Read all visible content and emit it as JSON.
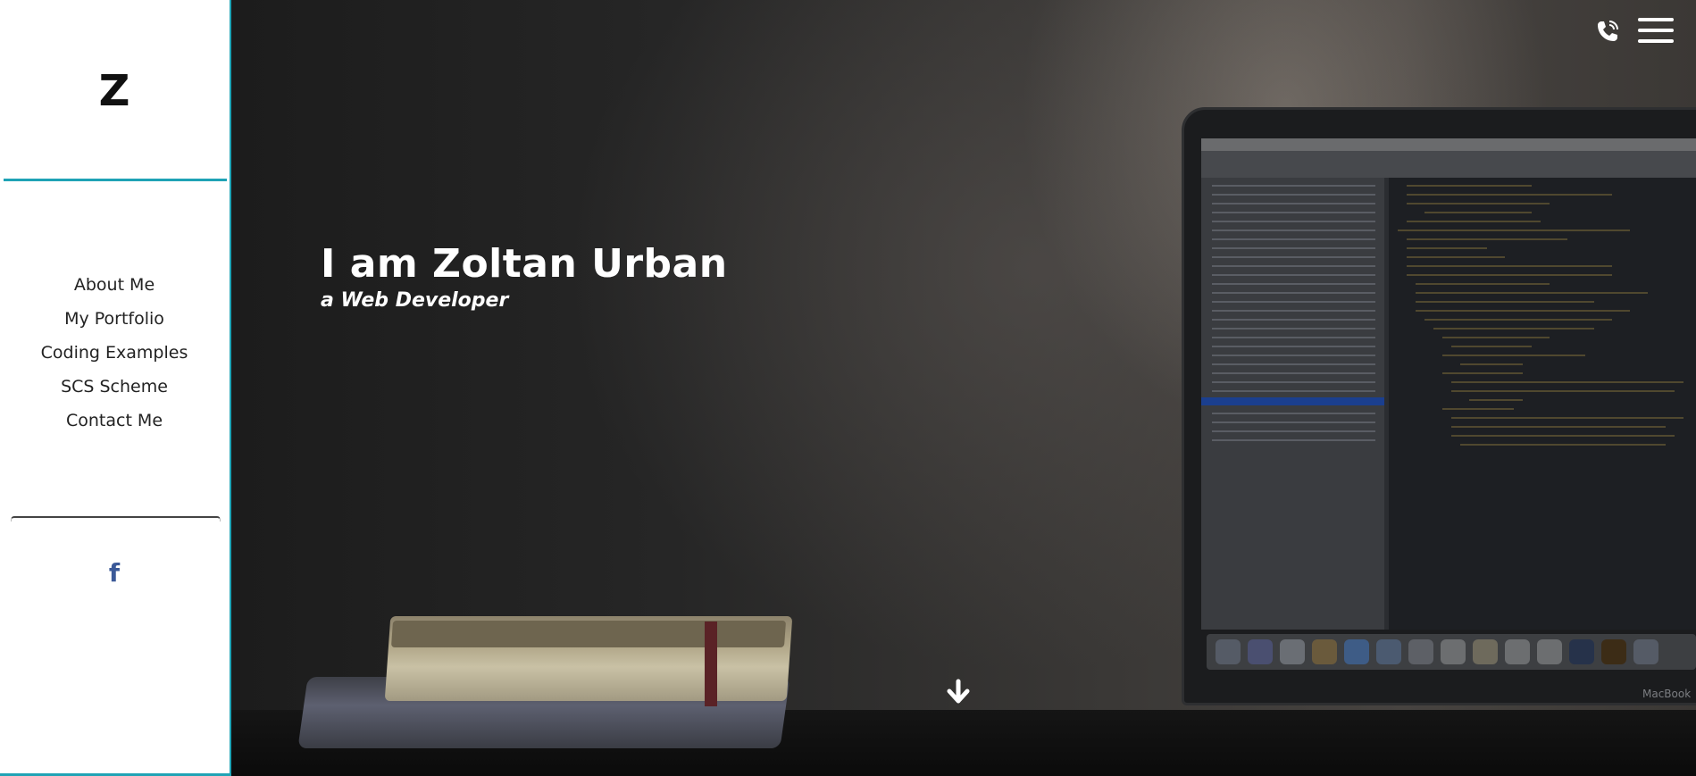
{
  "sidebar": {
    "logo": "Z",
    "nav_items": [
      {
        "label": "About Me"
      },
      {
        "label": "My Portfolio"
      },
      {
        "label": "Coding Examples"
      },
      {
        "label": "SCS Scheme"
      },
      {
        "label": "Contact Me"
      }
    ],
    "social": {
      "facebook_glyph": "f",
      "facebook_icon": "facebook-icon"
    }
  },
  "header": {
    "phone_icon": "phone-icon",
    "menu_icon": "hamburger-menu-icon"
  },
  "hero": {
    "title": "I am Zoltan Urban",
    "subtitle": "a Web Developer",
    "scroll_icon": "arrow-down-icon",
    "laptop_brand": "MacBook"
  },
  "colors": {
    "accent": "#1fa3b5",
    "facebook": "#3b5998",
    "sidebar_bg": "#ffffff",
    "hero_text": "#ffffff"
  }
}
